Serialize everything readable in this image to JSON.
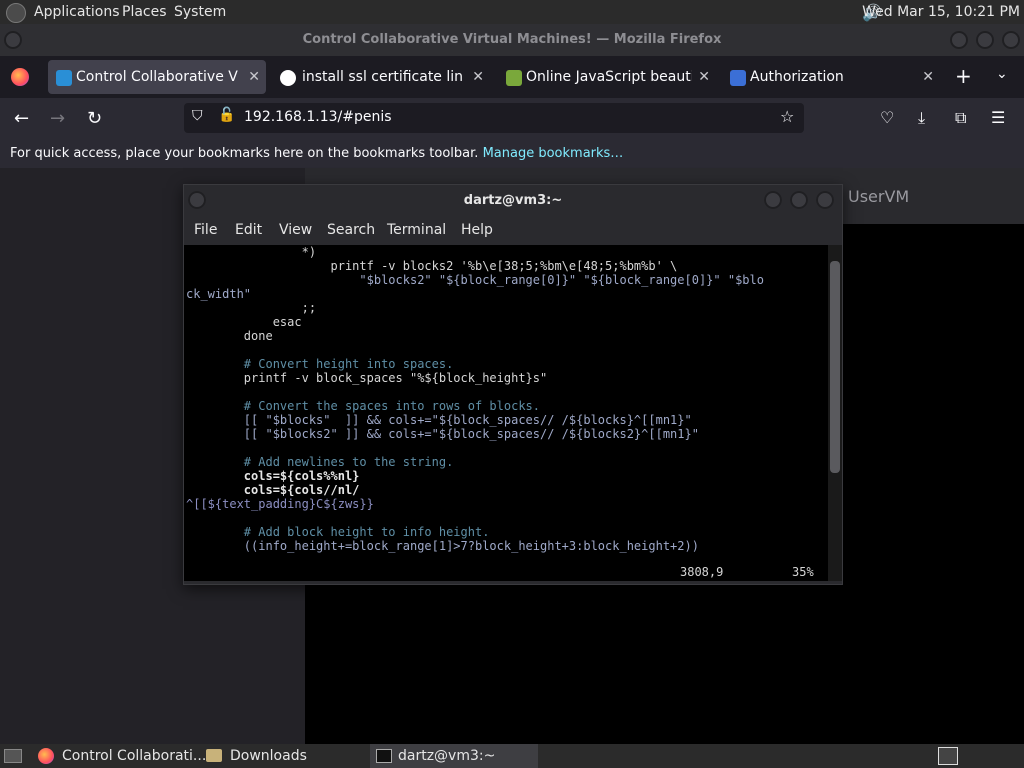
{
  "top_panel": {
    "menus": [
      "Applications",
      "Places",
      "System"
    ],
    "clock": "Wed Mar 15, 10:21 PM"
  },
  "firefox": {
    "window_title": "Control Collaborative Virtual Machines! — Mozilla Firefox",
    "tabs": [
      {
        "label": "Control Collaborative Virtual Machines!",
        "active": true
      },
      {
        "label": "install ssl certificate linux - Google Search",
        "active": false
      },
      {
        "label": "Online JavaScript beautifier",
        "active": false
      },
      {
        "label": "Authorization",
        "active": false
      }
    ],
    "url": "192.168.1.13/#penis",
    "bookmarks_bar": {
      "text": "For quick access, place your bookmarks here on the bookmarks toolbar.",
      "link": "Manage bookmarks…"
    }
  },
  "page": {
    "uservm_label": "UserVM"
  },
  "terminal": {
    "title": "dartz@vm3:~",
    "menu": [
      "File",
      "Edit",
      "View",
      "Search",
      "Terminal",
      "Help"
    ],
    "lines": [
      "                *)",
      "                    printf -v blocks2 '%b\\e[38;5;%bm\\e[48;5;%bm%b' \\",
      "                        \"$blocks2\" \"${block_range[0]}\" \"${block_range[0]}\" \"$blo",
      "ck_width\"",
      "                ;;",
      "            esac",
      "        done",
      "",
      "        # Convert height into spaces.",
      "        printf -v block_spaces \"%${block_height}s\"",
      "",
      "        # Convert the spaces into rows of blocks.",
      "        [[ \"$blocks\"  ]] && cols+=\"${block_spaces// /${blocks}^[[mn1}\"",
      "        [[ \"$blocks2\" ]] && cols+=\"${block_spaces// /${blocks2}^[[mn1}\"",
      "",
      "        # Add newlines to the string.",
      "        cols=${cols%%nl}",
      "        cols=${cols//nl/",
      "^[[${text_padding}C${zws}}",
      "",
      "        # Add block height to info height.",
      "        ((info_height+=block_range[1]>7?block_height+3:block_height+2))"
    ],
    "status_position": "3808,9",
    "status_percent": "35%"
  },
  "taskbar": {
    "items": [
      "Control Collaborati...",
      "Downloads",
      "dartz@vm3:~"
    ]
  }
}
